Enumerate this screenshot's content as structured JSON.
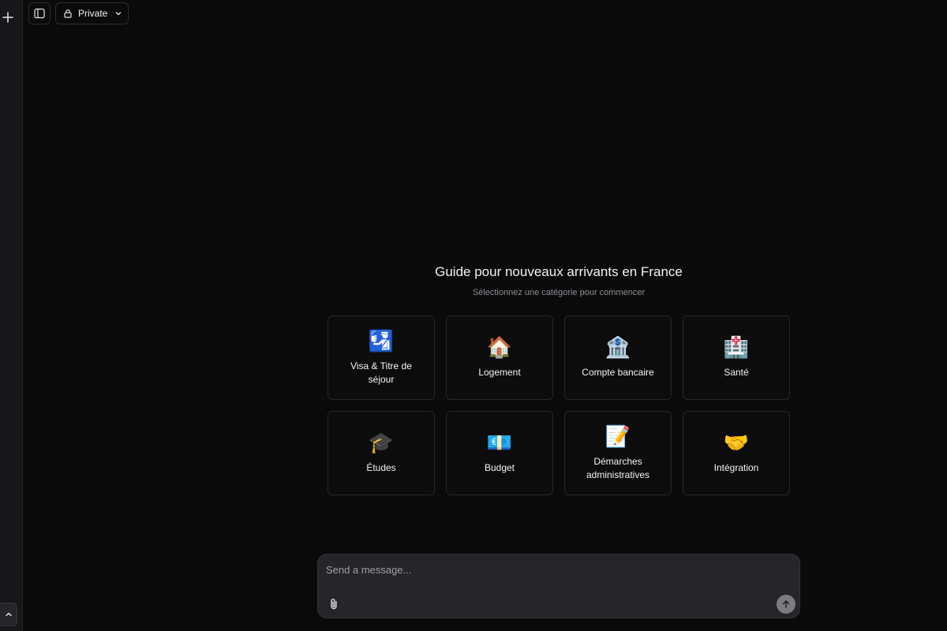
{
  "topbar": {
    "visibility_label": "Private",
    "icons": {
      "sidebar_toggle": "sidebar-toggle-icon",
      "lock": "lock-icon",
      "chevron": "chevron-down-icon"
    }
  },
  "rail": {
    "new_icon": "plus-icon",
    "expand_icon": "chevron-up-icon"
  },
  "hero": {
    "title": "Guide pour nouveaux arrivants en France",
    "subtitle": "Sélectionnez une catégorie pour commencer"
  },
  "categories": [
    {
      "emoji": "🛂",
      "icon": "passport-control-icon",
      "label": "Visa & Titre de séjour"
    },
    {
      "emoji": "🏠",
      "icon": "house-icon",
      "label": "Logement"
    },
    {
      "emoji": "🏦",
      "icon": "bank-icon",
      "label": "Compte bancaire"
    },
    {
      "emoji": "🏥",
      "icon": "hospital-icon",
      "label": "Santé"
    },
    {
      "emoji": "🎓",
      "icon": "graduation-cap-icon",
      "label": "Études"
    },
    {
      "emoji": "💶",
      "icon": "euro-banknote-icon",
      "label": "Budget"
    },
    {
      "emoji": "📝",
      "icon": "memo-icon",
      "label": "Démarches administratives"
    },
    {
      "emoji": "🤝",
      "icon": "handshake-icon",
      "label": "Intégration"
    }
  ],
  "composer": {
    "placeholder": "Send a message...",
    "value": "",
    "attach_icon": "paperclip-icon",
    "send_icon": "arrow-up-icon"
  },
  "colors": {
    "background": "#0a0a0b",
    "rail": "#17171a",
    "card_border": "#27272b",
    "composer": "#26262a",
    "send_button": "#7b7b82"
  }
}
